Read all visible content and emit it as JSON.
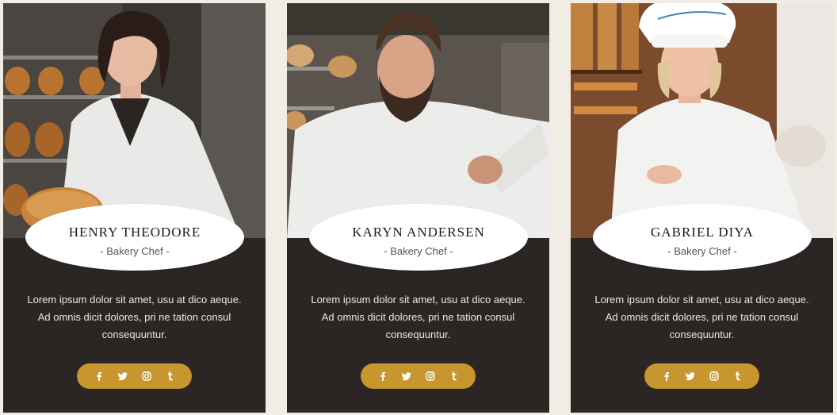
{
  "team": [
    {
      "name": "HENRY THEODORE",
      "role": "- Bakery Chef -",
      "bio": "Lorem ipsum dolor sit amet, usu at dico aeque. Ad omnis dicit dolores, pri ne tation consul consequuntur.",
      "social": [
        "facebook-icon",
        "twitter-icon",
        "instagram-icon",
        "tumblr-icon"
      ]
    },
    {
      "name": "KARYN ANDERSEN",
      "role": "- Bakery Chef -",
      "bio": "Lorem ipsum dolor sit amet, usu at dico aeque. Ad omnis dicit dolores, pri ne tation consul consequuntur.",
      "social": [
        "facebook-icon",
        "twitter-icon",
        "instagram-icon",
        "tumblr-icon"
      ]
    },
    {
      "name": "GABRIEL DIYA",
      "role": "- Bakery Chef -",
      "bio": "Lorem ipsum dolor sit amet, usu at dico aeque. Ad omnis dicit dolores, pri ne tation consul consequuntur.",
      "social": [
        "facebook-icon",
        "twitter-icon",
        "instagram-icon",
        "tumblr-icon"
      ]
    }
  ],
  "colors": {
    "page_bg": "#f1ece4",
    "card_bg": "#2b2624",
    "accent": "#c8962f",
    "name_plate": "#ffffff"
  }
}
